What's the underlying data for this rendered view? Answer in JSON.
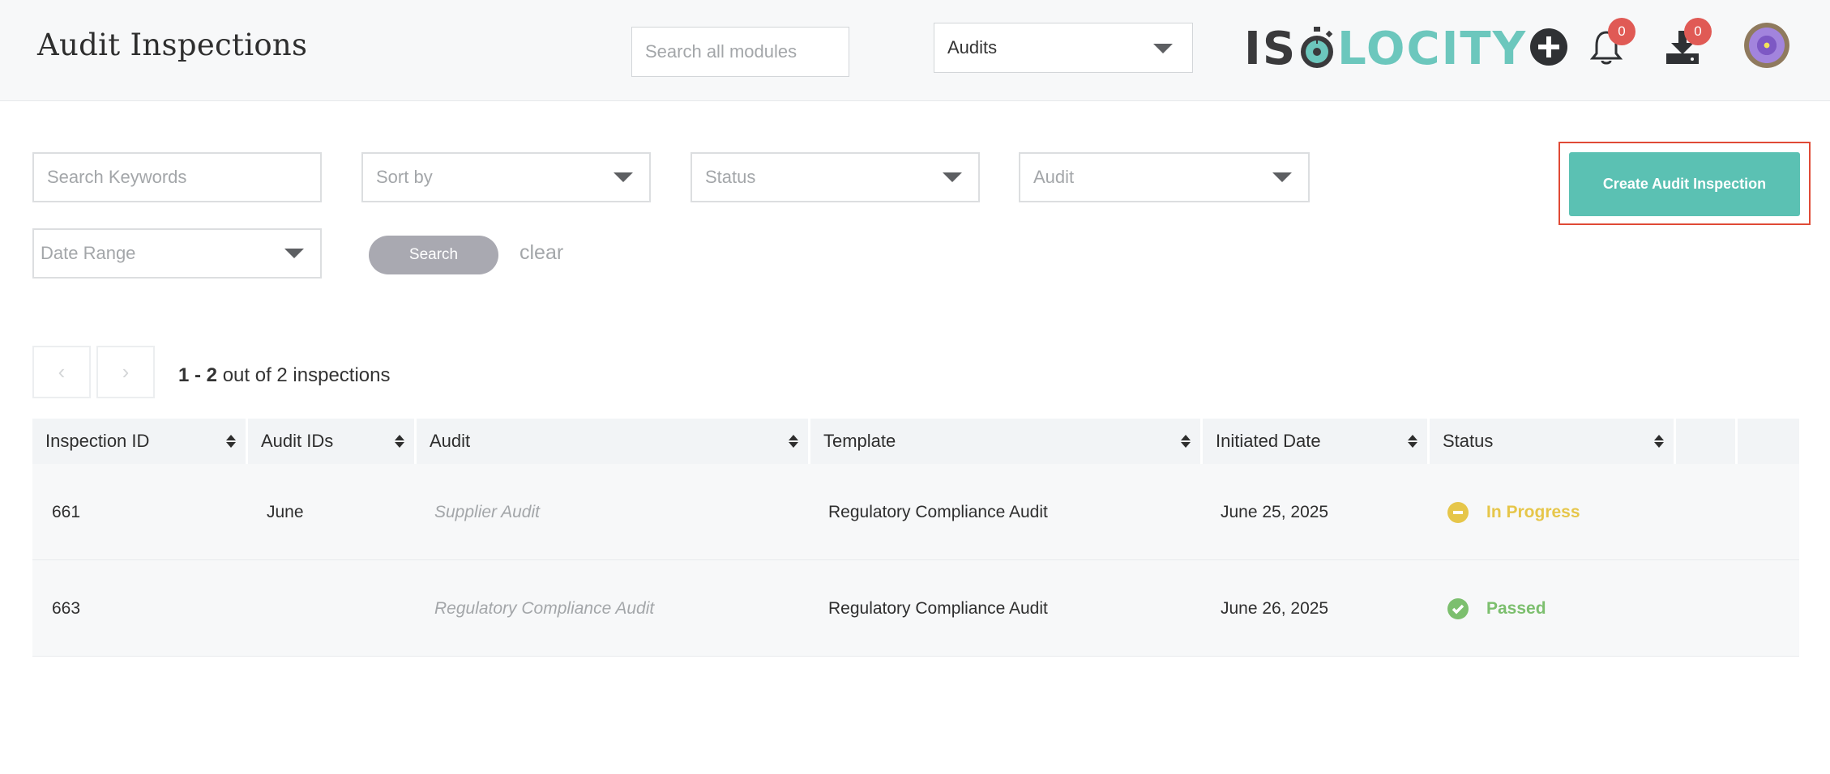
{
  "header": {
    "title": "Audit Inspections",
    "search_placeholder": "Search all modules",
    "module_select": "Audits",
    "logo_left": "IS",
    "logo_right": "LOCITY",
    "notifications_count": "0",
    "downloads_count": "0"
  },
  "filters": {
    "keywords_placeholder": "Search Keywords",
    "sort_by": "Sort by",
    "status": "Status",
    "audit": "Audit",
    "date_range": "Date Range",
    "search_label": "Search",
    "clear_label": "clear",
    "create_label": "Create Audit Inspection"
  },
  "pagination": {
    "range": "1 - 2",
    "suffix": " out of 2 inspections"
  },
  "table": {
    "columns": [
      "Inspection ID",
      "Audit IDs",
      "Audit",
      "Template",
      "Initiated Date",
      "Status"
    ],
    "rows": [
      {
        "id": "661",
        "audit_ids": "June",
        "audit": "Supplier Audit",
        "template": "Regulatory Compliance Audit",
        "date": "June 25, 2025",
        "status": "In Progress"
      },
      {
        "id": "663",
        "audit_ids": "",
        "audit": "Regulatory Compliance Audit",
        "template": "Regulatory Compliance Audit",
        "date": "June 26, 2025",
        "status": "Passed"
      }
    ]
  },
  "colors": {
    "accent": "#5bc1b3",
    "in_progress": "#e6c64a",
    "passed": "#7cbf6e",
    "highlight": "#e04a36"
  }
}
